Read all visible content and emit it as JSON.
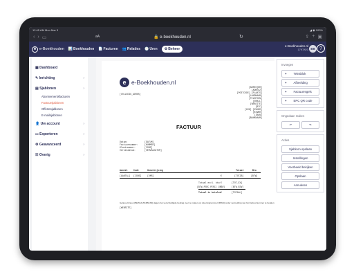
{
  "status_bar": {
    "time": "12:45 AM   Mon Mar 3",
    "right": "◢ ◉ 100%"
  },
  "browser": {
    "text_size": "aA",
    "url": "🔒 e-boekhouden.nl",
    "reload_icon": "reload-icon",
    "nav_icons": [
      "back-icon",
      "forward-icon",
      "tabs-icon"
    ],
    "right_icons": [
      "share-icon",
      "plus-icon",
      "tabs-grid-icon"
    ]
  },
  "app_nav": {
    "logo_text": "e-Boekhouden",
    "items": [
      {
        "label": "Boekhouden",
        "icon": "📊"
      },
      {
        "label": "Facturen",
        "icon": "📄"
      },
      {
        "label": "Relaties",
        "icon": "👥"
      },
      {
        "label": "Uren",
        "icon": "🕒"
      },
      {
        "label": "Beheer",
        "icon": "⚙",
        "active": true
      }
    ],
    "user_name": "e-Boekhouden.nl",
    "user_number": "1797/6/3",
    "avatar_initials": "EB",
    "help": "?"
  },
  "sidebar": {
    "items": [
      {
        "label": "Dashboard",
        "icon": "▦"
      },
      {
        "label": "Inrichting",
        "icon": "✎"
      },
      {
        "label": "Sjablonen",
        "icon": "▤"
      }
    ],
    "sub_items": [
      {
        "label": "Abonnementsfacturen"
      },
      {
        "label": "Factuursjablonen",
        "active": true
      },
      {
        "label": "Offertesjablonen"
      },
      {
        "label": "E-mailsjablonen"
      }
    ],
    "items_after": [
      {
        "label": "Uw account",
        "icon": "👤"
      },
      {
        "label": "Exporteren",
        "icon": "▭"
      },
      {
        "label": "Geavanceerd",
        "icon": "⚙"
      },
      {
        "label": "Overig",
        "icon": "☷"
      }
    ],
    "chevron": "›"
  },
  "invoice": {
    "logo_text": "e-Boekhouden.nl",
    "logo_letter": "e",
    "recipient": "[VOLLEDIG_ADRES]",
    "sender_lines": [
      "[ADRES]NR]",
      "[ADRES2]",
      "[POSTCODE] [PLAATS]",
      "[LANDNAAM]",
      "[TELEFOON]",
      "[EMAIL]",
      "[WEBSITE]",
      "[BIC]",
      "[KVK] [KVKNR]",
      "[BTWNR]",
      "[IBAN]",
      "[BANKNAAM]"
    ],
    "title": "FACTUUR",
    "meta_labels": [
      "Datum:",
      "Factuurnummer:",
      "Klantnummer:",
      "Vervaldatum:"
    ],
    "meta_values": [
      "[DATUM]",
      "[NUMMER]",
      "[CODE]",
      "[VERVALDATUM]"
    ],
    "table_headers": [
      "Aantal",
      "Code",
      "Omschrijving",
      "Totaal",
      "Btw"
    ],
    "table_row": [
      "[AANTAL]",
      "[CODE]",
      "[OMS]",
      "€",
      "[TOTZB]",
      "[BTW]"
    ],
    "totals": [
      {
        "label": "Totaal excl. btw",
        "cur": "€",
        "val": "[TOT_EX]"
      },
      {
        "label": "[BTW_PERC_PERC] [BTW]",
        "cur": "€",
        "val": "[BTW_BTW]"
      },
      {
        "label": "Totaal te betalen",
        "cur": "€",
        "val": "[TOTAAL]"
      }
    ],
    "footer_line1": "Gelieve binnen [BETAALTERMIJN] dagen het verschuldigde bedrag over te maken op rekeningnummer [IBAN] onder vermelding van het factuurnummer te betalen.",
    "footer_line2": "[WEBSITE]"
  },
  "right_panel": {
    "insert_title": "Invoegen",
    "insert_buttons": [
      {
        "label": "Tekstblok",
        "plus": "+"
      },
      {
        "label": "Afbeelding",
        "plus": "+"
      },
      {
        "label": "Factuurregels",
        "plus": "+"
      },
      {
        "label": "EPC QR code",
        "plus": "+"
      }
    ],
    "undo_title": "Ongedaan maken",
    "undo_icon": "↶",
    "redo_icon": "↷",
    "action_title": "Acties",
    "action_buttons": [
      "Sjabloon opslaan",
      "Instellingen",
      "Voorbeeld bekijken",
      "Opslaan",
      "Annuleren"
    ]
  }
}
